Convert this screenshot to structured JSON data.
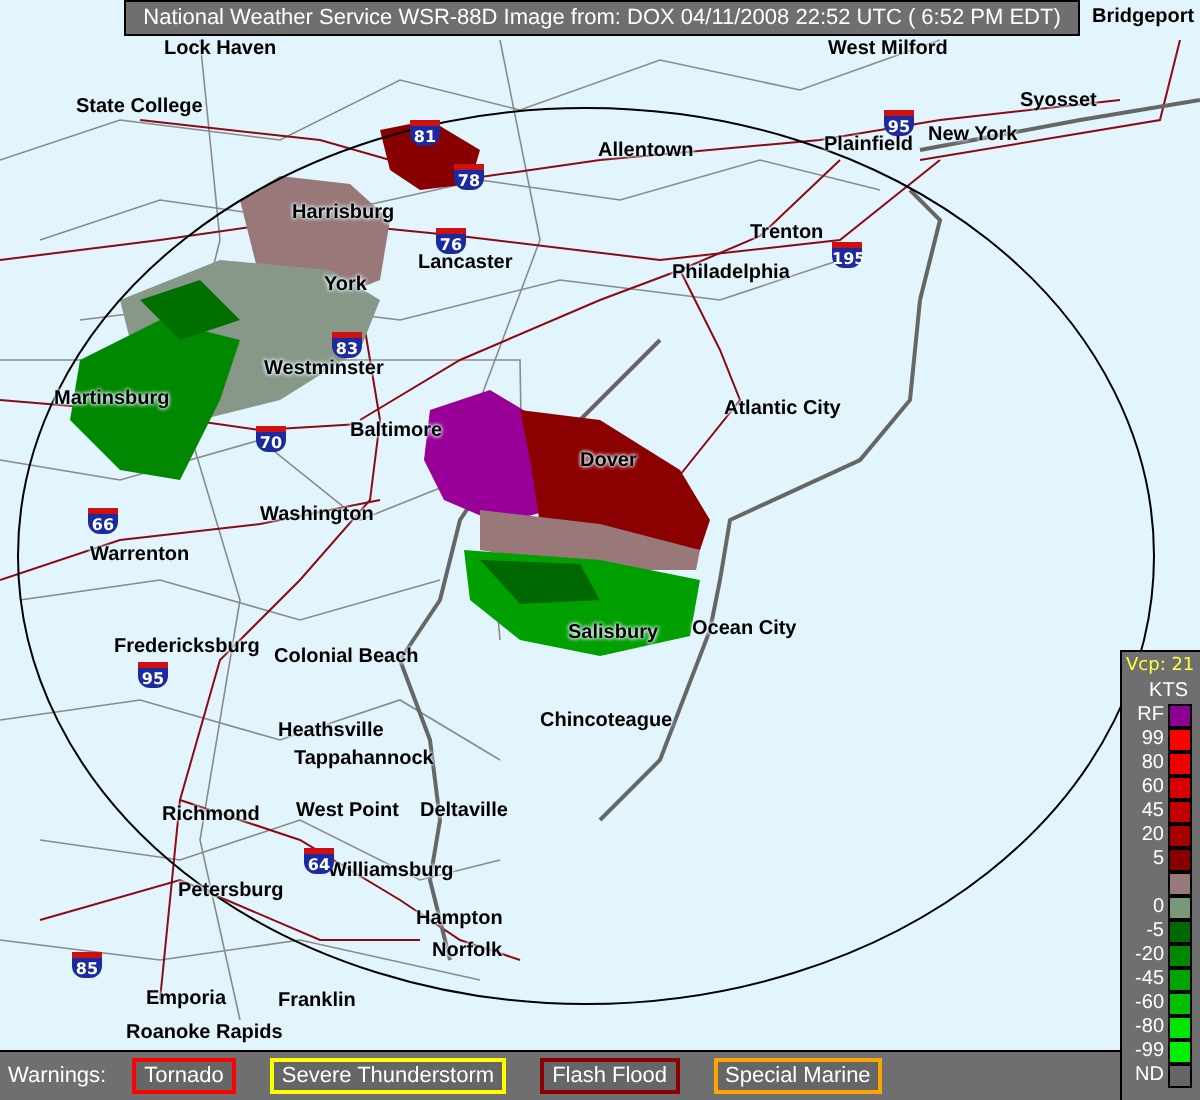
{
  "title": "National Weather Service WSR-88D Image from: DOX 04/11/2008 22:52 UTC ( 6:52 PM EDT)",
  "map": {
    "cities": [
      "Lock Haven",
      "West Milford",
      "Bridgeport",
      "State College",
      "Allentown",
      "Plainfield",
      "New York",
      "Syosset",
      "Harrisburg",
      "Trenton",
      "Lancaster",
      "Philadelphia",
      "York",
      "Westminster",
      "Martinsburg",
      "Baltimore",
      "Dover",
      "Atlantic City",
      "Washington",
      "Warrenton",
      "Salisbury",
      "Ocean City",
      "Fredericksburg",
      "Colonial Beach",
      "Heathsville",
      "Chincoteague",
      "Tappahannock",
      "Richmond",
      "West Point",
      "Deltaville",
      "Williamsburg",
      "Petersburg",
      "Hampton",
      "Norfolk",
      "Emporia",
      "Franklin",
      "Roanoke Rapids"
    ],
    "highways": [
      "81",
      "78",
      "76",
      "83",
      "70",
      "95",
      "195",
      "66",
      "95",
      "64",
      "85"
    ]
  },
  "legend": {
    "mode": "Vcp: 21",
    "unit": "KTS",
    "entries": [
      {
        "label": "RF",
        "color": "#8e0094"
      },
      {
        "label": "99",
        "color": "#ff0000"
      },
      {
        "label": "80",
        "color": "#ee0000"
      },
      {
        "label": "60",
        "color": "#d80000"
      },
      {
        "label": "45",
        "color": "#c00000"
      },
      {
        "label": "20",
        "color": "#a80000"
      },
      {
        "label": "5",
        "color": "#880000"
      },
      {
        "color": "#987878"
      },
      {
        "label": "0",
        "color": "#789878"
      },
      {
        "label": "-5",
        "color": "#006800"
      },
      {
        "label": "-20",
        "color": "#008800"
      },
      {
        "label": "-45",
        "color": "#00a400"
      },
      {
        "label": "-60",
        "color": "#00c000"
      },
      {
        "label": "-80",
        "color": "#00e400"
      },
      {
        "label": "-99",
        "color": "#00f000"
      },
      {
        "label": "ND",
        "color": "#666666"
      }
    ]
  },
  "warnings": {
    "label": "Warnings:",
    "items": [
      {
        "name": "Tornado",
        "color": "#ff0000"
      },
      {
        "name": "Severe Thunderstorm",
        "color": "#ffff00"
      },
      {
        "name": "Flash Flood",
        "color": "#8b0000"
      },
      {
        "name": "Special Marine",
        "color": "#ffa500"
      }
    ]
  }
}
